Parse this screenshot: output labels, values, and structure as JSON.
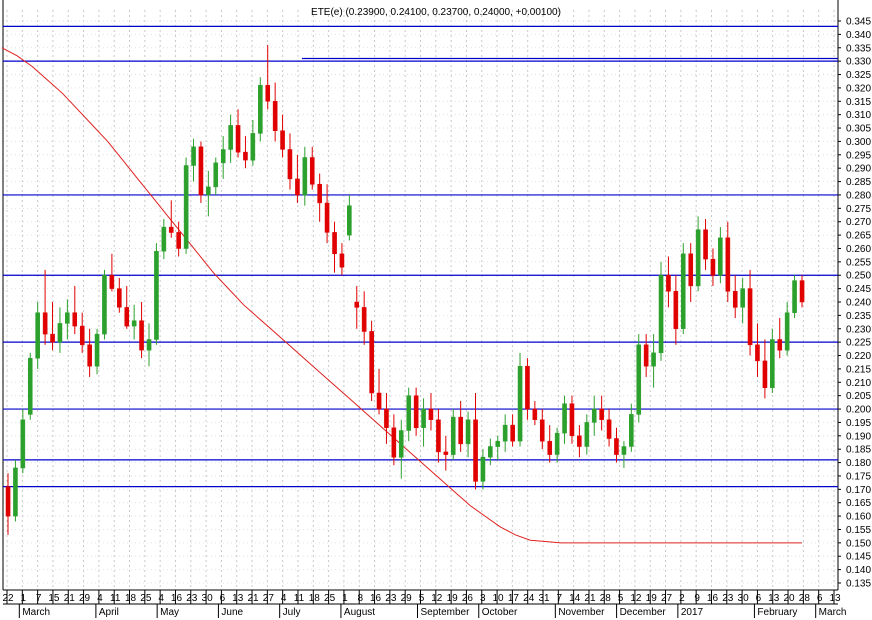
{
  "chart_data": {
    "type": "candlestick",
    "title": "ETE(e) (0.23900, 0.24100, 0.23700, 0.24000, +0.00100)",
    "ylim": [
      0.135,
      0.345
    ],
    "ytick_step": 0.005,
    "y_ticks": [
      "0.345",
      "0.340",
      "0.335",
      "0.330",
      "0.325",
      "0.320",
      "0.315",
      "0.310",
      "0.305",
      "0.300",
      "0.295",
      "0.290",
      "0.285",
      "0.280",
      "0.275",
      "0.270",
      "0.265",
      "0.260",
      "0.255",
      "0.250",
      "0.245",
      "0.240",
      "0.235",
      "0.230",
      "0.225",
      "0.220",
      "0.215",
      "0.210",
      "0.205",
      "0.200",
      "0.195",
      "0.190",
      "0.185",
      "0.180",
      "0.175",
      "0.170",
      "0.165",
      "0.160",
      "0.155",
      "0.150",
      "0.145",
      "0.140",
      "0.135"
    ],
    "x_day_ticks": [
      "22",
      "1",
      "7",
      "15",
      "21",
      "29",
      "4",
      "11",
      "18",
      "25",
      "4",
      "16",
      "23",
      "30",
      "6",
      "13",
      "21",
      "27",
      "4",
      "11",
      "18",
      "25",
      "1",
      "8",
      "16",
      "23",
      "29",
      "5",
      "12",
      "19",
      "26",
      "3",
      "10",
      "17",
      "24",
      "31",
      "7",
      "14",
      "21",
      "28",
      "5",
      "12",
      "19",
      "27",
      "2",
      "9",
      "16",
      "23",
      "30",
      "6",
      "13",
      "20",
      "28",
      "6",
      "13"
    ],
    "x_month_labels": [
      "March",
      "April",
      "May",
      "June",
      "July",
      "August",
      "September",
      "October",
      "November",
      "December",
      "2017",
      "February",
      "March"
    ],
    "horizontal_levels": [
      0.343,
      0.33,
      0.28,
      0.25,
      0.225,
      0.2,
      0.181,
      0.171
    ],
    "resistance_segment": {
      "from_index": 45,
      "value": 0.331
    },
    "grid": true,
    "up_color": "#2ca02c",
    "down_color": "#e00000",
    "level_color": "#0000cc",
    "ma_color": "#e02020",
    "moving_average": [
      0.335,
      0.332,
      0.328,
      0.323,
      0.318,
      0.312,
      0.306,
      0.3,
      0.293,
      0.286,
      0.279,
      0.272,
      0.265,
      0.258,
      0.251,
      0.245,
      0.239,
      0.234,
      0.229,
      0.224,
      0.219,
      0.214,
      0.209,
      0.204,
      0.199,
      0.194,
      0.189,
      0.184,
      0.179,
      0.174,
      0.169,
      0.164,
      0.16,
      0.156,
      0.153,
      0.151,
      0.1505,
      0.15,
      0.15,
      0.15,
      0.15,
      0.15,
      0.15,
      0.15,
      0.15,
      0.15,
      0.15,
      0.15,
      0.15,
      0.15,
      0.15,
      0.15,
      0.15,
      0.15
    ],
    "ohlc": [
      [
        0.171,
        0.176,
        0.153,
        0.16
      ],
      [
        0.16,
        0.181,
        0.158,
        0.178
      ],
      [
        0.178,
        0.2,
        0.176,
        0.196
      ],
      [
        0.198,
        0.221,
        0.196,
        0.219
      ],
      [
        0.219,
        0.24,
        0.215,
        0.236
      ],
      [
        0.236,
        0.252,
        0.224,
        0.228
      ],
      [
        0.228,
        0.24,
        0.222,
        0.225
      ],
      [
        0.225,
        0.238,
        0.221,
        0.232
      ],
      [
        0.232,
        0.241,
        0.226,
        0.236
      ],
      [
        0.236,
        0.246,
        0.228,
        0.231
      ],
      [
        0.231,
        0.236,
        0.221,
        0.224
      ],
      [
        0.224,
        0.23,
        0.212,
        0.216
      ],
      [
        0.216,
        0.23,
        0.213,
        0.228
      ],
      [
        0.228,
        0.252,
        0.226,
        0.25
      ],
      [
        0.25,
        0.258,
        0.244,
        0.245
      ],
      [
        0.245,
        0.249,
        0.236,
        0.238
      ],
      [
        0.238,
        0.246,
        0.23,
        0.231
      ],
      [
        0.231,
        0.239,
        0.226,
        0.233
      ],
      [
        0.233,
        0.24,
        0.219,
        0.222
      ],
      [
        0.222,
        0.232,
        0.216,
        0.226
      ],
      [
        0.226,
        0.262,
        0.224,
        0.259
      ],
      [
        0.259,
        0.271,
        0.256,
        0.268
      ],
      [
        0.268,
        0.278,
        0.264,
        0.266
      ],
      [
        0.266,
        0.27,
        0.257,
        0.26
      ],
      [
        0.26,
        0.294,
        0.258,
        0.291
      ],
      [
        0.291,
        0.301,
        0.285,
        0.298
      ],
      [
        0.298,
        0.3,
        0.277,
        0.28
      ],
      [
        0.28,
        0.289,
        0.272,
        0.283
      ],
      [
        0.283,
        0.294,
        0.28,
        0.292
      ],
      [
        0.292,
        0.302,
        0.286,
        0.297
      ],
      [
        0.297,
        0.31,
        0.292,
        0.306
      ],
      [
        0.306,
        0.312,
        0.294,
        0.296
      ],
      [
        0.296,
        0.302,
        0.29,
        0.293
      ],
      [
        0.293,
        0.308,
        0.291,
        0.303
      ],
      [
        0.303,
        0.324,
        0.3,
        0.321
      ],
      [
        0.321,
        0.336,
        0.312,
        0.315
      ],
      [
        0.315,
        0.322,
        0.3,
        0.304
      ],
      [
        0.304,
        0.31,
        0.294,
        0.297
      ],
      [
        0.297,
        0.303,
        0.282,
        0.286
      ],
      [
        0.286,
        0.295,
        0.277,
        0.28
      ],
      [
        0.28,
        0.298,
        0.276,
        0.294
      ],
      [
        0.294,
        0.298,
        0.282,
        0.284
      ],
      [
        0.284,
        0.288,
        0.27,
        0.277
      ],
      [
        0.277,
        0.284,
        0.262,
        0.266
      ],
      [
        0.266,
        0.27,
        0.251,
        0.258
      ],
      [
        0.258,
        0.262,
        0.25,
        0.253
      ],
      [
        0.265,
        0.28,
        0.263,
        0.276
      ],
      [
        0.24,
        0.246,
        0.23,
        0.238
      ],
      [
        0.238,
        0.244,
        0.224,
        0.229
      ],
      [
        0.229,
        0.233,
        0.203,
        0.206
      ],
      [
        0.206,
        0.215,
        0.198,
        0.2
      ],
      [
        0.2,
        0.206,
        0.187,
        0.193
      ],
      [
        0.193,
        0.198,
        0.179,
        0.182
      ],
      [
        0.182,
        0.196,
        0.174,
        0.192
      ],
      [
        0.192,
        0.208,
        0.188,
        0.205
      ],
      [
        0.205,
        0.208,
        0.19,
        0.193
      ],
      [
        0.193,
        0.204,
        0.186,
        0.2
      ],
      [
        0.2,
        0.206,
        0.192,
        0.196
      ],
      [
        0.196,
        0.2,
        0.18,
        0.184
      ],
      [
        0.184,
        0.19,
        0.177,
        0.183
      ],
      [
        0.183,
        0.2,
        0.181,
        0.197
      ],
      [
        0.197,
        0.203,
        0.184,
        0.187
      ],
      [
        0.187,
        0.199,
        0.182,
        0.196
      ],
      [
        0.196,
        0.206,
        0.17,
        0.173
      ],
      [
        0.173,
        0.185,
        0.17,
        0.182
      ],
      [
        0.182,
        0.189,
        0.179,
        0.186
      ],
      [
        0.186,
        0.19,
        0.181,
        0.188
      ],
      [
        0.188,
        0.198,
        0.184,
        0.194
      ],
      [
        0.194,
        0.198,
        0.186,
        0.188
      ],
      [
        0.188,
        0.221,
        0.186,
        0.216
      ],
      [
        0.216,
        0.219,
        0.196,
        0.2
      ],
      [
        0.2,
        0.203,
        0.194,
        0.196
      ],
      [
        0.196,
        0.2,
        0.185,
        0.188
      ],
      [
        0.188,
        0.194,
        0.18,
        0.183
      ],
      [
        0.183,
        0.193,
        0.18,
        0.191
      ],
      [
        0.191,
        0.205,
        0.187,
        0.202
      ],
      [
        0.202,
        0.205,
        0.187,
        0.19
      ],
      [
        0.19,
        0.194,
        0.182,
        0.186
      ],
      [
        0.186,
        0.198,
        0.183,
        0.195
      ],
      [
        0.195,
        0.205,
        0.19,
        0.2
      ],
      [
        0.2,
        0.205,
        0.192,
        0.196
      ],
      [
        0.196,
        0.2,
        0.186,
        0.189
      ],
      [
        0.189,
        0.193,
        0.18,
        0.183
      ],
      [
        0.183,
        0.188,
        0.178,
        0.186
      ],
      [
        0.186,
        0.202,
        0.184,
        0.198
      ],
      [
        0.198,
        0.228,
        0.195,
        0.224
      ],
      [
        0.224,
        0.228,
        0.212,
        0.216
      ],
      [
        0.216,
        0.228,
        0.208,
        0.221
      ],
      [
        0.221,
        0.255,
        0.218,
        0.25
      ],
      [
        0.25,
        0.257,
        0.238,
        0.244
      ],
      [
        0.244,
        0.25,
        0.224,
        0.23
      ],
      [
        0.23,
        0.262,
        0.228,
        0.258
      ],
      [
        0.258,
        0.262,
        0.24,
        0.246
      ],
      [
        0.246,
        0.272,
        0.244,
        0.267
      ],
      [
        0.267,
        0.271,
        0.252,
        0.256
      ],
      [
        0.256,
        0.26,
        0.246,
        0.25
      ],
      [
        0.25,
        0.268,
        0.247,
        0.264
      ],
      [
        0.264,
        0.27,
        0.24,
        0.244
      ],
      [
        0.244,
        0.25,
        0.234,
        0.238
      ],
      [
        0.238,
        0.249,
        0.232,
        0.245
      ],
      [
        0.245,
        0.252,
        0.22,
        0.224
      ],
      [
        0.224,
        0.232,
        0.212,
        0.218
      ],
      [
        0.218,
        0.226,
        0.204,
        0.208
      ],
      [
        0.208,
        0.23,
        0.206,
        0.226
      ],
      [
        0.226,
        0.234,
        0.219,
        0.222
      ],
      [
        0.222,
        0.24,
        0.22,
        0.236
      ],
      [
        0.236,
        0.25,
        0.234,
        0.248
      ],
      [
        0.248,
        0.25,
        0.238,
        0.24
      ]
    ]
  }
}
